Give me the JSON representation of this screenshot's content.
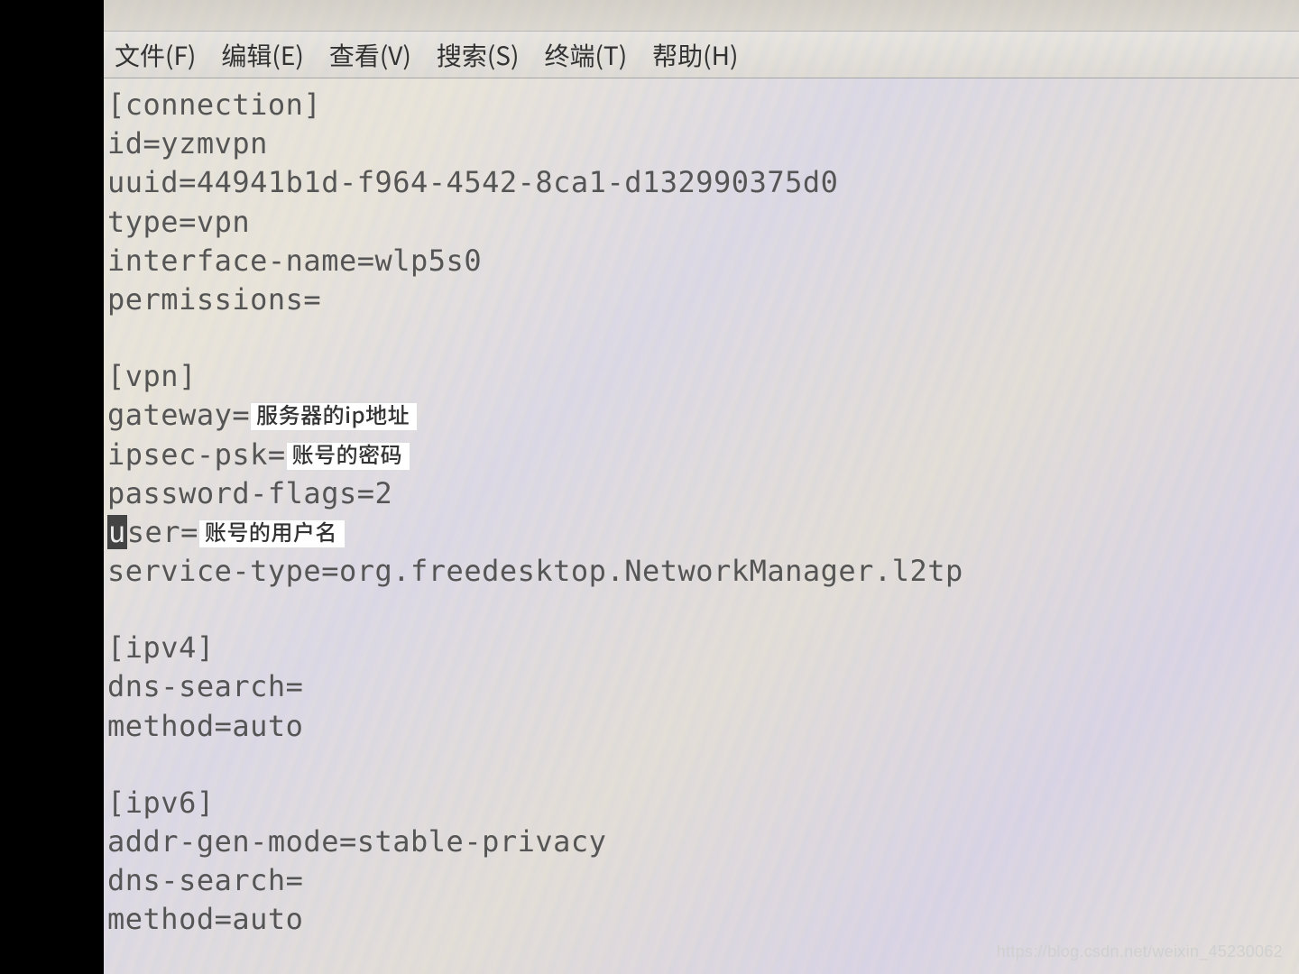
{
  "menu": {
    "file": "文件(F)",
    "edit": "编辑(E)",
    "view": "查看(V)",
    "search": "搜索(S)",
    "terminal": "终端(T)",
    "help": "帮助(H)"
  },
  "config": {
    "section_connection": "[connection]",
    "id_line": "id=yzmvpn",
    "uuid_line": "uuid=44941b1d-f964-4542-8ca1-d132990375d0",
    "type_line": "type=vpn",
    "interface_line": "interface-name=wlp5s0",
    "permissions_line": "permissions=",
    "section_vpn": "[vpn]",
    "gateway_prefix": "gateway=",
    "gateway_note": "服务器的ip地址",
    "ipsec_prefix": "ipsec-psk=",
    "ipsec_note": "账号的密码",
    "pwflags_line": "password-flags=2",
    "user_first": "u",
    "user_rest": "ser=",
    "user_note": "账号的用户名",
    "service_line": "service-type=org.freedesktop.NetworkManager.l2tp",
    "section_ipv4": "[ipv4]",
    "dns4_line": "dns-search=",
    "method4_line": "method=auto",
    "section_ipv6": "[ipv6]",
    "addrgen_line": "addr-gen-mode=stable-privacy",
    "dns6_line": "dns-search=",
    "method6_line": "method=auto"
  },
  "watermark": "https://blog.csdn.net/weixin_45230062"
}
